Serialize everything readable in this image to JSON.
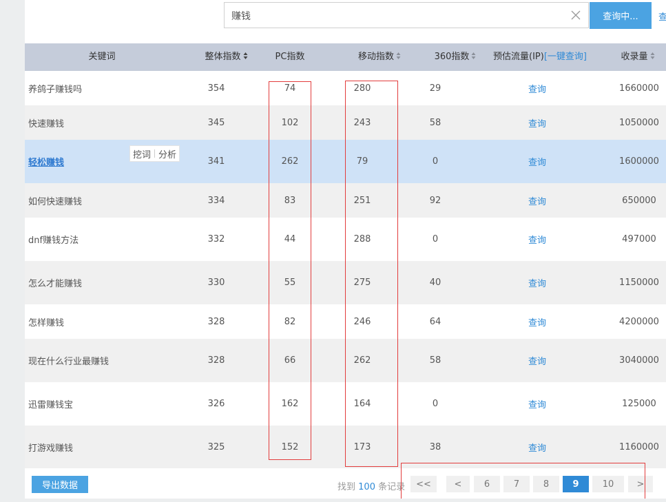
{
  "search": {
    "value": "赚钱",
    "button_label": "查询中...",
    "extra_label": "查"
  },
  "table": {
    "headers": {
      "keyword": "关键词",
      "overall_index": "整体指数",
      "pc_index": "PC指数",
      "mobile_index": "移动指数",
      "index_360": "360指数",
      "traffic": "预估流量(IP)",
      "traffic_link": "[一键查询]",
      "indexed": "收录量"
    },
    "query_label": "查询",
    "row_tools": {
      "dig": "挖词",
      "analyze": "分析"
    },
    "rows": [
      {
        "keyword": "养鸽子赚钱吗",
        "overall": "354",
        "pc": "74",
        "mobile": "280",
        "i360": "29",
        "indexed": "1660000"
      },
      {
        "keyword": "快速赚钱",
        "overall": "345",
        "pc": "102",
        "mobile": "243",
        "i360": "58",
        "indexed": "1050000"
      },
      {
        "keyword": "轻松赚钱",
        "overall": "341",
        "pc": "262",
        "mobile": "79",
        "i360": "0",
        "indexed": "1600000"
      },
      {
        "keyword": "如何快速赚钱",
        "overall": "334",
        "pc": "83",
        "mobile": "251",
        "i360": "92",
        "indexed": "650000"
      },
      {
        "keyword": "dnf赚钱方法",
        "overall": "332",
        "pc": "44",
        "mobile": "288",
        "i360": "0",
        "indexed": "497000"
      },
      {
        "keyword": "怎么才能赚钱",
        "overall": "330",
        "pc": "55",
        "mobile": "275",
        "i360": "40",
        "indexed": "1150000"
      },
      {
        "keyword": "怎样赚钱",
        "overall": "328",
        "pc": "82",
        "mobile": "246",
        "i360": "64",
        "indexed": "4200000"
      },
      {
        "keyword": "现在什么行业最赚钱",
        "overall": "328",
        "pc": "66",
        "mobile": "262",
        "i360": "58",
        "indexed": "3040000"
      },
      {
        "keyword": "迅雷赚钱宝",
        "overall": "326",
        "pc": "162",
        "mobile": "164",
        "i360": "0",
        "indexed": "125000"
      },
      {
        "keyword": "打游戏赚钱",
        "overall": "325",
        "pc": "152",
        "mobile": "173",
        "i360": "38",
        "indexed": "1160000"
      }
    ]
  },
  "footer": {
    "export_label": "导出数据",
    "records_prefix": "找到",
    "records_count": "100",
    "records_suffix": "条记录",
    "pagination": [
      "<<",
      "<",
      "6",
      "7",
      "8",
      "9",
      "10",
      ">"
    ],
    "current_page": "9"
  },
  "colors": {
    "accent": "#2f8ad6",
    "button": "#4ba3e2",
    "header_bg": "#c5ccda",
    "highlight_row": "#cfe2f7",
    "annotation_red": "#e23b3b"
  }
}
